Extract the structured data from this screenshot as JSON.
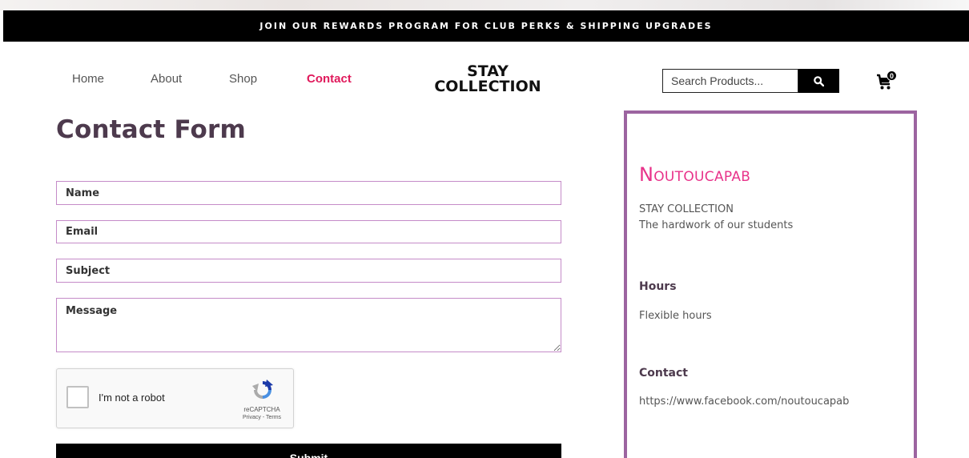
{
  "promo": {
    "text": "JOIN OUR REWARDS PROGRAM FOR CLUB PERKS & SHIPPING UPGRADES"
  },
  "nav": {
    "items": [
      {
        "label": "Home",
        "active": false
      },
      {
        "label": "About",
        "active": false
      },
      {
        "label": "Shop",
        "active": false
      },
      {
        "label": "Contact",
        "active": true
      }
    ],
    "active_color": "#e0195b"
  },
  "logo": {
    "line1": "STAY",
    "line2": "COLLECTION"
  },
  "search": {
    "placeholder": "Search Products...",
    "icon": "search-icon"
  },
  "cart": {
    "count": "0",
    "icon": "cart-icon"
  },
  "main": {
    "title": "Contact Form",
    "fields": {
      "name_placeholder": "Name",
      "email_placeholder": "Email",
      "subject_placeholder": "Subject",
      "message_placeholder": "Message"
    },
    "captcha": {
      "label": "I'm not a robot",
      "brand": "reCAPTCHA",
      "links": "Privacy - Terms"
    },
    "submit_label": "Submit"
  },
  "sidebar": {
    "brand": "Noutoucapab",
    "company": "STAY COLLECTION",
    "tagline": "The hardwork of our students",
    "hours_heading": "Hours",
    "hours_text": "Flexible hours",
    "contact_heading": "Contact",
    "contact_url": "https://www.facebook.com/noutoucapab",
    "border_color": "#9c64a0",
    "brand_color": "#e8338a"
  }
}
